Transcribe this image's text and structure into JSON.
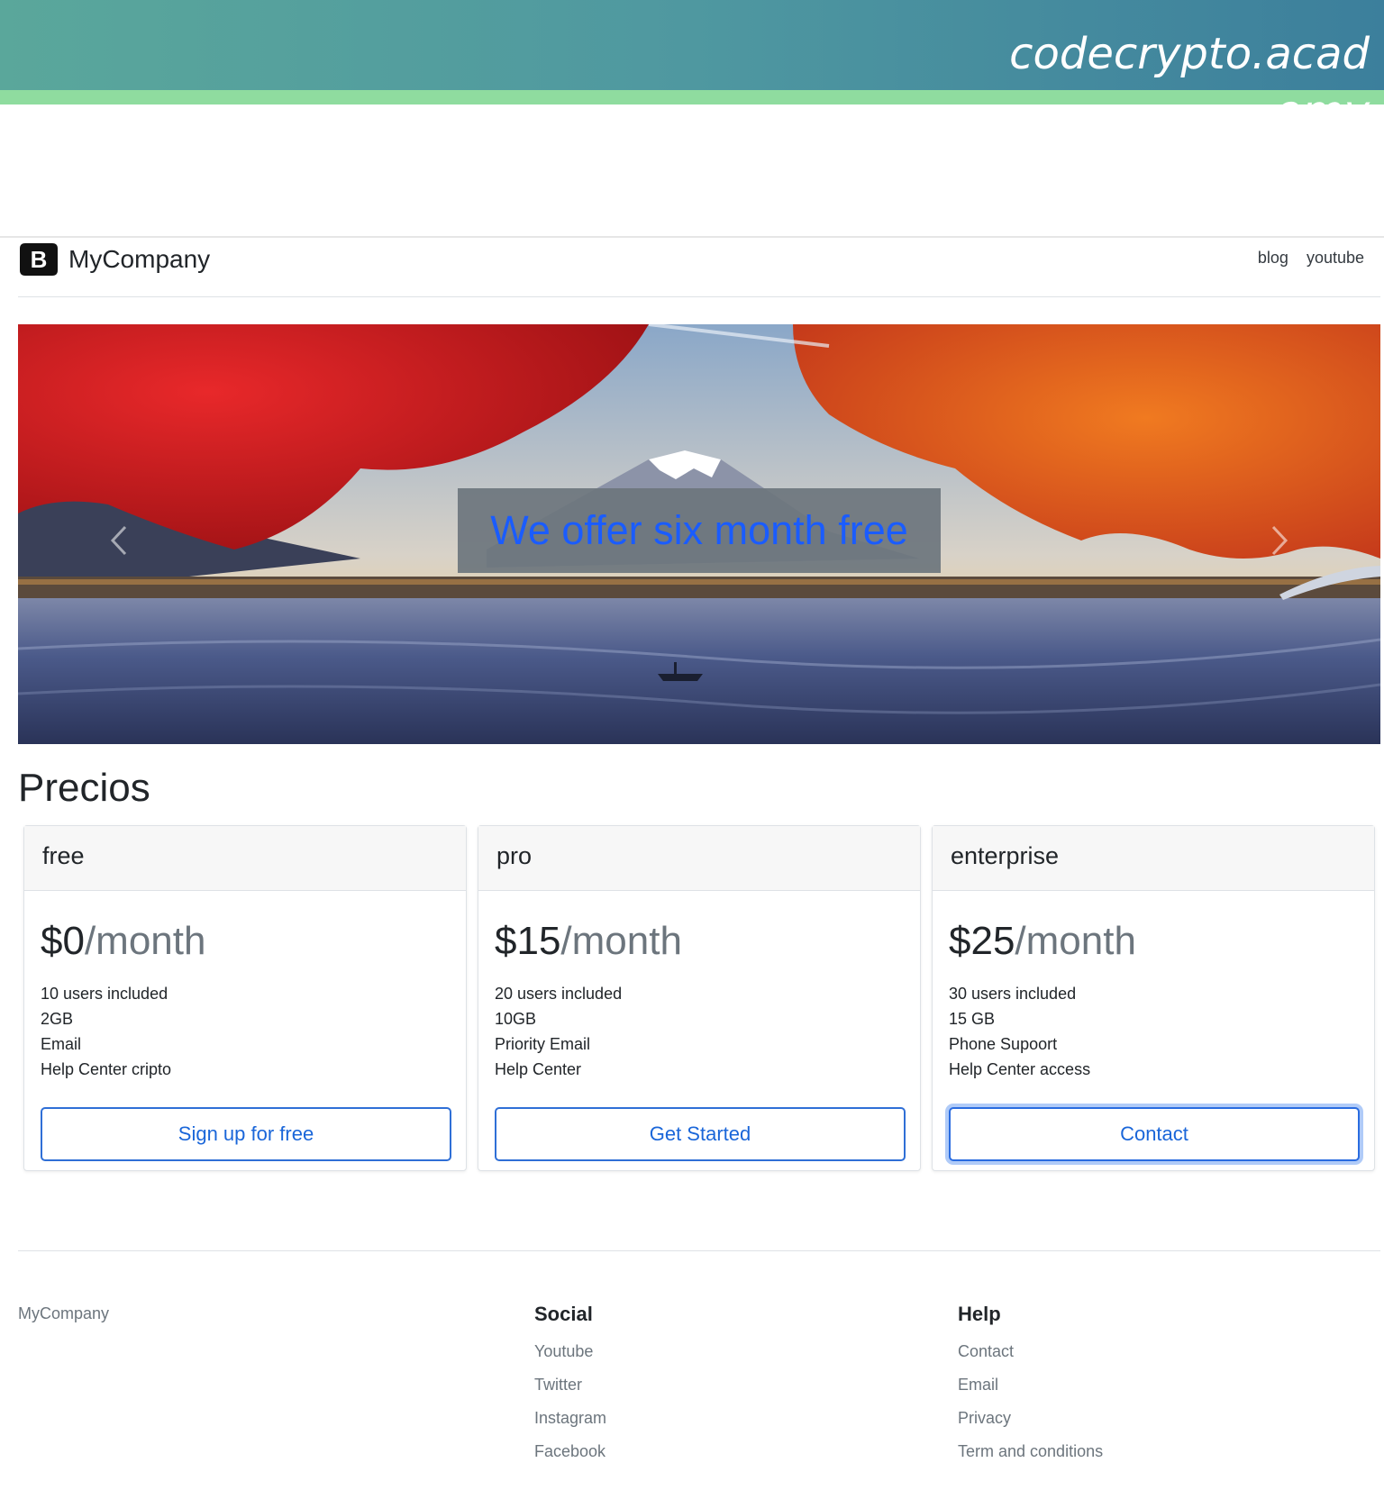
{
  "banner": {
    "brand": "codecrypto.academy"
  },
  "header": {
    "logo_letter": "B",
    "brand_name": "MyCompany",
    "nav": [
      {
        "label": "blog"
      },
      {
        "label": "youtube"
      }
    ]
  },
  "hero": {
    "caption": "We offer six month free",
    "image_alt": "Mount Fuji lake landscape with red autumn maple leaves"
  },
  "pricing": {
    "title": "Precios",
    "plans": [
      {
        "name": "free",
        "amount": "$0",
        "period": "/month",
        "features": [
          "10 users included",
          "2GB",
          "Email",
          "Help Center cripto"
        ],
        "button": "Sign up for free"
      },
      {
        "name": "pro",
        "amount": "$15",
        "period": "/month",
        "features": [
          "20 users included",
          "10GB",
          "Priority Email",
          "Help Center"
        ],
        "button": "Get Started"
      },
      {
        "name": "enterprise",
        "amount": "$25",
        "period": "/month",
        "features": [
          "30 users included",
          "15 GB",
          "Phone Supoort",
          "Help Center access"
        ],
        "button": "Contact"
      }
    ]
  },
  "footer": {
    "brand": "MyCompany",
    "social": {
      "title": "Social",
      "links": [
        "Youtube",
        "Twitter",
        "Instagram",
        "Facebook"
      ]
    },
    "help": {
      "title": "Help",
      "links": [
        "Contact",
        "Email",
        "Privacy",
        "Term and conditions"
      ]
    }
  }
}
